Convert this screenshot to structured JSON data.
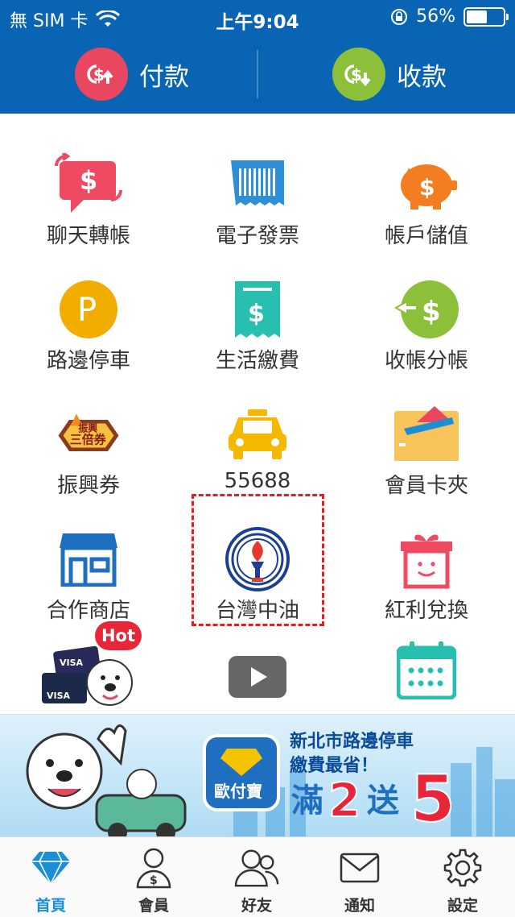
{
  "status": {
    "carrier": "無 SIM 卡",
    "time": "上午9:04",
    "battery": "56%",
    "battery_level": 0.56
  },
  "paybar": {
    "pay_label": "付款",
    "receive_label": "收款"
  },
  "grid": [
    {
      "label": "聊天轉帳"
    },
    {
      "label": "電子發票"
    },
    {
      "label": "帳戶儲值"
    },
    {
      "label": "路邊停車"
    },
    {
      "label": "生活繳費"
    },
    {
      "label": "收帳分帳"
    },
    {
      "label": "振興券"
    },
    {
      "label": "55688"
    },
    {
      "label": "會員卡夾"
    },
    {
      "label": "合作商店"
    },
    {
      "label": "台灣中油"
    },
    {
      "label": "紅利兌換"
    }
  ],
  "hot_badge": "Hot",
  "voucher_icon_text": {
    "line1": "振興",
    "line2": "三倍券"
  },
  "card_text": "VISA",
  "banner": {
    "brand": "歐付寶",
    "line1": "新北市路邊停車",
    "line2": "繳費最省！",
    "promo_1": "滿",
    "promo_2": "2",
    "promo_3": "送",
    "promo_4": "5"
  },
  "tabs": [
    {
      "label": "首頁"
    },
    {
      "label": "會員"
    },
    {
      "label": "好友"
    },
    {
      "label": "通知"
    },
    {
      "label": "設定"
    }
  ],
  "colors": {
    "topbar": "#0a64b4",
    "pay": "#e8475f",
    "receive": "#8cbf3a",
    "tab_active": "#1a8fd8",
    "highlight": "#e02020"
  }
}
